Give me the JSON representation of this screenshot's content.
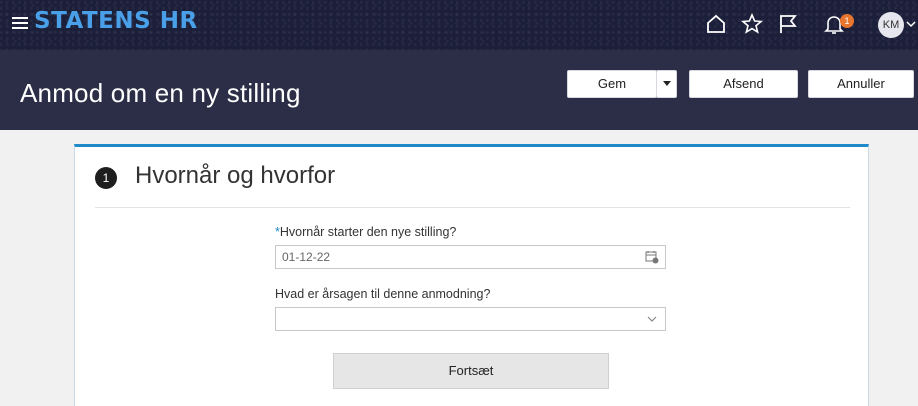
{
  "header": {
    "brand": "STATENS HR",
    "notification_count": "1",
    "avatar_initials": "KM",
    "icons": [
      "menu-icon",
      "home-icon",
      "star-icon",
      "flag-icon",
      "bell-icon",
      "chevron-down-icon"
    ]
  },
  "titlebar": {
    "title": "Anmod om en ny stilling",
    "save_label": "Gem",
    "send_label": "Afsend",
    "cancel_label": "Annuller"
  },
  "section": {
    "step_number": "1",
    "title": "Hvornår og hvorfor",
    "start_date_label": "Hvornår starter den nye stilling?",
    "start_date_required_mark": "*",
    "start_date_value": "01-12-22",
    "reason_label": "Hvad er årsagen til denne anmodning?",
    "reason_value": "",
    "continue_label": "Fortsæt"
  },
  "colors": {
    "topbar_bg": "#1c1f3a",
    "titlebar_bg": "#2b2e46",
    "brand": "#4aa0e8",
    "accent": "#1f8ac9",
    "badge": "#e8752e"
  }
}
